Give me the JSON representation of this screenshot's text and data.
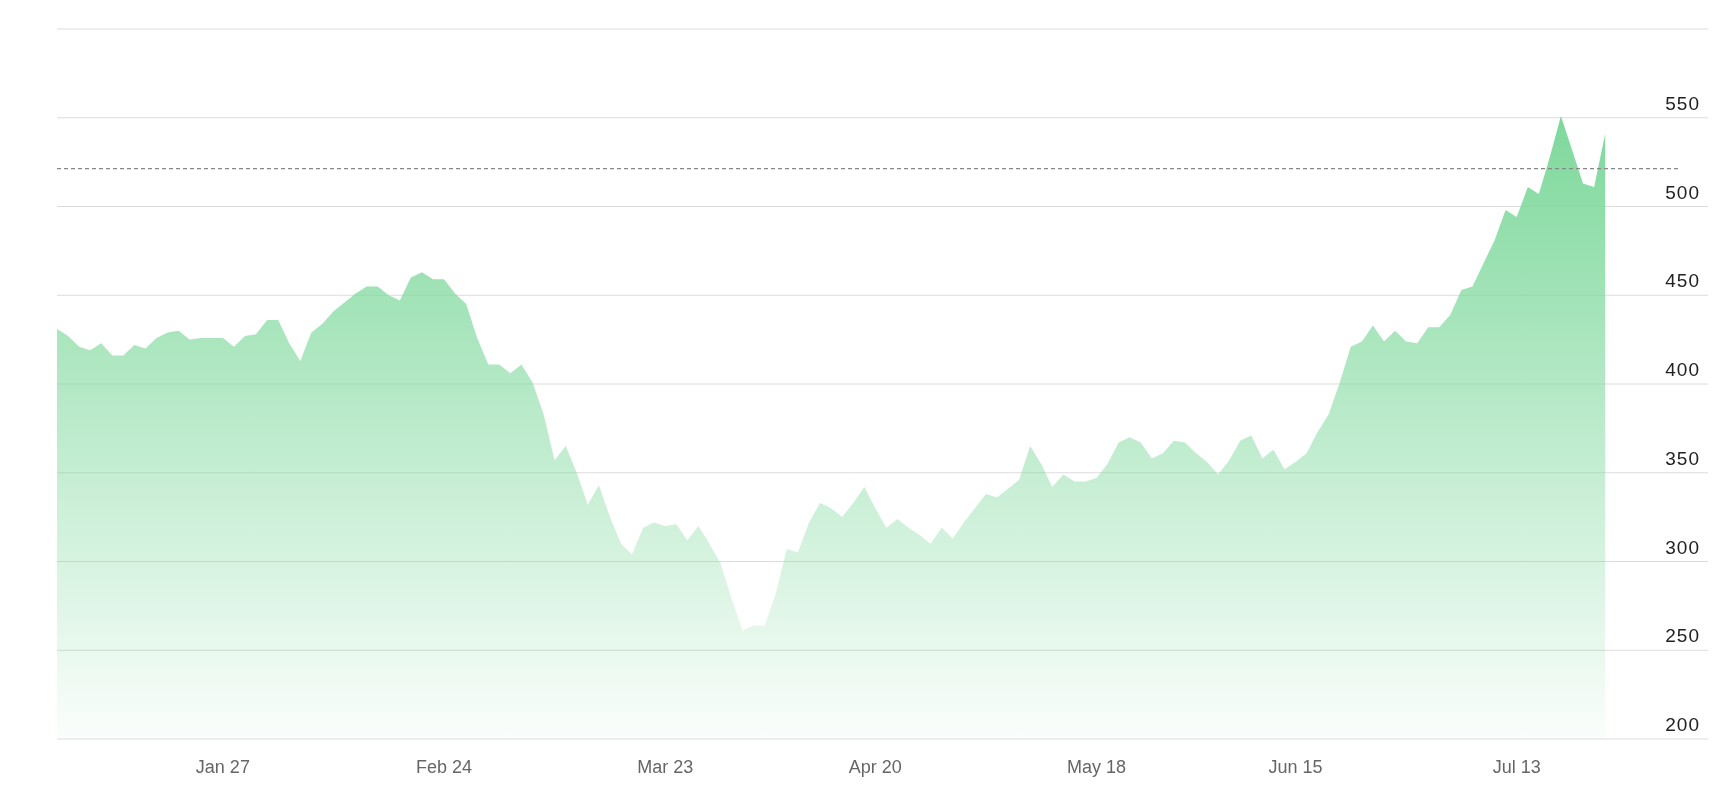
{
  "chart": {
    "chart_data": {
      "type": "area",
      "categories": [
        null,
        null,
        null,
        null,
        null,
        null,
        null,
        null,
        null,
        null,
        null,
        null,
        null,
        null,
        null,
        "Jan 27",
        null,
        null,
        null,
        null,
        null,
        null,
        null,
        null,
        null,
        null,
        null,
        null,
        null,
        null,
        null,
        null,
        null,
        null,
        null,
        "Feb 24",
        null,
        null,
        null,
        null,
        null,
        null,
        null,
        null,
        null,
        null,
        null,
        null,
        null,
        null,
        null,
        null,
        null,
        null,
        null,
        "Mar 23",
        null,
        null,
        null,
        null,
        null,
        null,
        null,
        null,
        null,
        null,
        null,
        null,
        null,
        null,
        null,
        null,
        null,
        null,
        "Apr 20",
        null,
        null,
        null,
        null,
        null,
        null,
        null,
        null,
        null,
        null,
        null,
        null,
        null,
        null,
        null,
        null,
        null,
        null,
        null,
        "May 18",
        null,
        null,
        null,
        null,
        null,
        null,
        null,
        null,
        null,
        null,
        null,
        null,
        null,
        null,
        null,
        null,
        null,
        "Jun 15",
        null,
        null,
        null,
        null,
        null,
        null,
        null,
        null,
        null,
        null,
        null,
        null,
        null,
        null,
        null,
        null,
        null,
        null,
        null,
        "Jul 13",
        null,
        null,
        null,
        null,
        null,
        null,
        null,
        null
      ],
      "series": [
        {
          "color": "#7dd89b",
          "values": [
            431,
            427,
            421,
            419,
            423,
            416,
            416,
            422,
            420,
            426,
            429,
            430,
            425,
            426,
            426,
            426,
            421,
            427,
            428,
            436,
            436,
            423,
            413,
            429,
            434,
            441,
            446,
            451,
            455,
            455,
            450,
            447,
            460,
            463,
            459,
            459,
            451,
            445,
            426,
            411,
            411,
            406,
            411,
            401,
            383,
            357,
            365,
            350,
            332,
            343,
            325,
            310,
            304,
            319,
            322,
            320,
            321,
            312,
            320,
            310,
            299,
            279,
            261,
            264,
            264,
            282,
            307,
            305,
            322,
            333,
            330,
            325,
            333,
            342,
            330,
            319,
            324,
            319,
            315,
            310,
            319,
            313,
            322,
            330,
            338,
            336,
            341,
            346,
            365,
            355,
            342,
            349,
            345,
            345,
            347,
            355,
            367,
            370,
            367,
            358,
            361,
            368,
            367,
            361,
            356,
            349,
            357,
            368,
            371,
            358,
            363,
            352,
            356,
            361,
            373,
            383,
            401,
            421,
            424,
            433,
            424,
            430,
            424,
            423,
            432,
            432,
            439,
            453,
            455,
            468,
            481,
            498,
            494,
            511,
            507,
            528,
            551,
            532,
            513,
            511,
            541
          ]
        }
      ],
      "ylim": [
        200,
        600
      ],
      "grid": true,
      "yticks": [
        200,
        250,
        300,
        350,
        400,
        450,
        500,
        550
      ],
      "ref_lines": [
        {
          "axis": "y",
          "value": 521.3
        }
      ]
    }
  }
}
